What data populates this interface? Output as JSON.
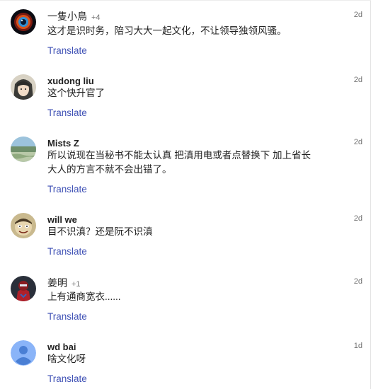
{
  "translate_label": "Translate",
  "comments": [
    {
      "author": "一隻小鳥",
      "plus": "+4",
      "time": "2d",
      "lines": [
        "这才是识时务，陪习大大一起文化，不让领导独领风骚。"
      ],
      "avatar_icon": "galaxy-eye-avatar"
    },
    {
      "author": "xudong liu",
      "plus": "",
      "time": "2d",
      "lines": [
        "这个快升官了"
      ],
      "avatar_icon": "anime-character-avatar"
    },
    {
      "author": "Mists Z",
      "plus": "",
      "time": "2d",
      "lines": [
        "所以说现在当秘书不能太认真 把滇用电或者点替换下 加上省长",
        "大人的方言不就不会出错了。"
      ],
      "avatar_icon": "landscape-avatar"
    },
    {
      "author": "will we",
      "plus": "",
      "time": "2d",
      "lines": [
        "目不识滇？还是阮不识滇"
      ],
      "avatar_icon": "cartoon-face-avatar"
    },
    {
      "author": "姜明",
      "plus": "+1",
      "time": "2d",
      "lines": [
        "上有通商宽衣......"
      ],
      "avatar_icon": "superhero-avatar"
    },
    {
      "author": "wd bai",
      "plus": "",
      "time": "1d",
      "lines": [
        "啥文化呀"
      ],
      "avatar_icon": "default-person-avatar"
    }
  ],
  "colors": {
    "link": "#3f51b5",
    "text": "#212121",
    "meta": "#757575",
    "default_avatar_bg": "#8ab4f8",
    "default_avatar_fg": "#4a7fd4"
  }
}
